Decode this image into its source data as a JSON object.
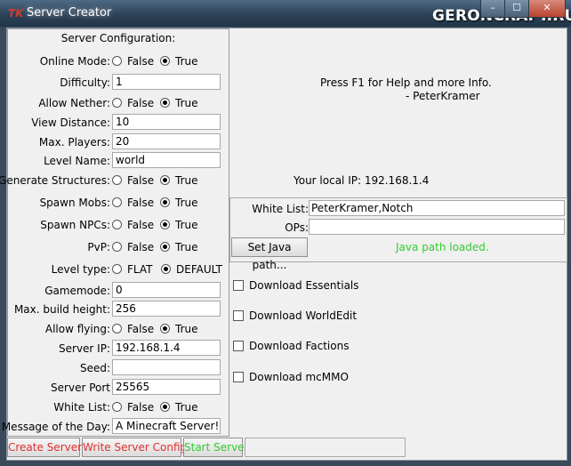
{
  "window": {
    "app_icon": "TK",
    "title": "Server Creator",
    "watermark": "GERONCRAFT.RU",
    "minimize": "–",
    "maximize": "☐",
    "close": "✕"
  },
  "config": {
    "title": "Server Configuration:",
    "fields": [
      {
        "label": "Online Mode:",
        "type": "radio",
        "options": [
          "False",
          "True"
        ],
        "selected": "True"
      },
      {
        "label": "Difficulty:",
        "type": "text",
        "value": "1"
      },
      {
        "label": "Allow Nether:",
        "type": "radio",
        "options": [
          "False",
          "True"
        ],
        "selected": "True"
      },
      {
        "label": "View Distance:",
        "type": "text",
        "value": "10"
      },
      {
        "label": "Max. Players:",
        "type": "text",
        "value": "20"
      },
      {
        "label": "Level Name:",
        "type": "text",
        "value": "world"
      },
      {
        "label": "Generate Structures:",
        "type": "radio",
        "options": [
          "False",
          "True"
        ],
        "selected": "True"
      },
      {
        "label": "Spawn Mobs:",
        "type": "radio",
        "options": [
          "False",
          "True"
        ],
        "selected": "True"
      },
      {
        "label": "Spawn NPCs:",
        "type": "radio",
        "options": [
          "False",
          "True"
        ],
        "selected": "True"
      },
      {
        "label": "PvP:",
        "type": "radio",
        "options": [
          "False",
          "True"
        ],
        "selected": "True"
      },
      {
        "label": "Level type:",
        "type": "radio",
        "options": [
          "FLAT",
          "DEFAULT"
        ],
        "selected": "DEFAULT"
      },
      {
        "label": "Gamemode:",
        "type": "text",
        "value": "0"
      },
      {
        "label": "Max. build height:",
        "type": "text",
        "value": "256"
      },
      {
        "label": "Allow flying:",
        "type": "radio",
        "options": [
          "False",
          "True"
        ],
        "selected": "True"
      },
      {
        "label": "Server IP:",
        "type": "text",
        "value": "192.168.1.4"
      },
      {
        "label": "Seed:",
        "type": "text",
        "value": ""
      },
      {
        "label": "Server Port",
        "type": "text",
        "value": "25565"
      },
      {
        "label": "White List:",
        "type": "radio",
        "options": [
          "False",
          "True"
        ],
        "selected": "True"
      },
      {
        "label": "Message of the Day:",
        "type": "text",
        "value": "A Minecraft Server!"
      }
    ]
  },
  "buttons": {
    "create_server": "Create Server!",
    "write_config": "Write Server Config",
    "start_server": "Start Server"
  },
  "info": {
    "help_line1": "Press F1 for Help and more Info.",
    "help_line2": "- PeterKramer",
    "local_ip": "Your local IP: 192.168.1.4"
  },
  "lists": {
    "whitelist_label": "White List:",
    "whitelist_value": "PeterKramer,Notch",
    "ops_label": "OPs:",
    "ops_value": "",
    "java_button": "Set Java path...",
    "java_status": "Java path loaded."
  },
  "downloads": [
    {
      "label": "Download Essentials",
      "checked": false
    },
    {
      "label": "Download WorldEdit",
      "checked": false
    },
    {
      "label": "Download Factions",
      "checked": false
    },
    {
      "label": "Download mcMMO",
      "checked": false
    }
  ],
  "colors": {
    "error_red": "#e03030",
    "success_green": "#33cc33"
  }
}
